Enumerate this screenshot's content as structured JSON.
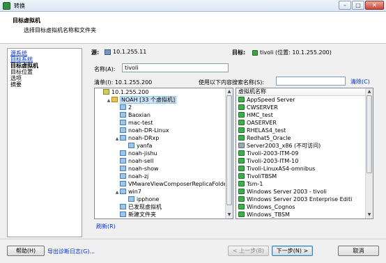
{
  "window": {
    "title": "转换",
    "controls": {
      "minimize": "–",
      "maximize": "□",
      "close": "✕"
    }
  },
  "header": {
    "title": "目标虚拟机",
    "subtitle": "选择目标虚拟机名称和文件夹"
  },
  "steps": [
    {
      "label": "源系统",
      "state": "link"
    },
    {
      "label": "目标系统",
      "state": "link"
    },
    {
      "label": "目标虚拟机",
      "state": "current"
    },
    {
      "label": "目标位置",
      "state": "pending"
    },
    {
      "label": "选项",
      "state": "pending"
    },
    {
      "label": "摘要",
      "state": "pending"
    }
  ],
  "source": {
    "label": "源:",
    "value": "10.1.255.11"
  },
  "target": {
    "label": "目标:",
    "value": "tivoli (位置: 10.1.255.200)"
  },
  "name_field": {
    "label": "名称(A):",
    "value": "tivoli"
  },
  "inventory": {
    "label": "清单(I): 10.1.255.200"
  },
  "search": {
    "label": "使用以下内容搜索名称(S):",
    "value": "",
    "clear_label": "清除(C)"
  },
  "tree": [
    {
      "label": "10.1.255.200",
      "indent": 0,
      "expander": "",
      "icon": "datacenter"
    },
    {
      "label": "NOAH [33 个虚拟机]",
      "indent": 1,
      "expander": "▲",
      "icon": "folder",
      "selected": true
    },
    {
      "label": "2",
      "indent": 2,
      "expander": "",
      "icon": "vmfolder"
    },
    {
      "label": "Baoxian",
      "indent": 2,
      "expander": "",
      "icon": "vmfolder"
    },
    {
      "label": "mac-test",
      "indent": 2,
      "expander": "",
      "icon": "vmfolder"
    },
    {
      "label": "noah-DR-Linux",
      "indent": 2,
      "expander": "",
      "icon": "vmfolder"
    },
    {
      "label": "noah-DRxp",
      "indent": 2,
      "expander": "▲",
      "icon": "vmfolder"
    },
    {
      "label": "yanfa",
      "indent": 3,
      "expander": "",
      "icon": "vmfolder"
    },
    {
      "label": "noah-jishu",
      "indent": 2,
      "expander": "",
      "icon": "vmfolder"
    },
    {
      "label": "noah-sell",
      "indent": 2,
      "expander": "",
      "icon": "vmfolder"
    },
    {
      "label": "noah-show",
      "indent": 2,
      "expander": "",
      "icon": "vmfolder"
    },
    {
      "label": "noah-zj",
      "indent": 2,
      "expander": "",
      "icon": "vmfolder"
    },
    {
      "label": "VMwareViewComposerReplicaFolde",
      "indent": 2,
      "expander": "",
      "icon": "vmfolder"
    },
    {
      "label": "win7",
      "indent": 2,
      "expander": "▲",
      "icon": "vmfolder"
    },
    {
      "label": "ipphone",
      "indent": 3,
      "expander": "",
      "icon": "vmfolder"
    },
    {
      "label": "已发现虚拟机",
      "indent": 2,
      "expander": "",
      "icon": "vmfolder"
    },
    {
      "label": "新建文件夹",
      "indent": 2,
      "expander": "",
      "icon": "vmfolder"
    }
  ],
  "vm_list": {
    "column_header": "虚拟机名称",
    "items": [
      {
        "name": "AppSpeed Server",
        "state": "on"
      },
      {
        "name": "CWSERVER",
        "state": "on"
      },
      {
        "name": "HMC_test",
        "state": "on"
      },
      {
        "name": "OASERVER",
        "state": "on"
      },
      {
        "name": "RHELAS4_test",
        "state": "on"
      },
      {
        "name": "Redhat5_Oracle",
        "state": "on"
      },
      {
        "name": "Server2003_x86 (不可访问)",
        "state": "off"
      },
      {
        "name": "Tivoli-2003-ITM-09",
        "state": "on"
      },
      {
        "name": "Tivoli-2003-ITM-10",
        "state": "on"
      },
      {
        "name": "Tivoli-LinuxAS4-omnibus",
        "state": "on"
      },
      {
        "name": "TivoliTBSM",
        "state": "on"
      },
      {
        "name": "Tsm-1",
        "state": "on"
      },
      {
        "name": "Windows Server 2003 - tivoli",
        "state": "on"
      },
      {
        "name": "Windows Server 2003 Enterprise Editi",
        "state": "on"
      },
      {
        "name": "Windows_Cognos",
        "state": "on"
      },
      {
        "name": "Windows_TBSM",
        "state": "on"
      }
    ]
  },
  "refresh_label": "刷新(R)",
  "footer": {
    "help_label": "帮助(H)",
    "export_label": "导出诊断日志(G)...",
    "back_label": "< 上一步(B)",
    "next_label": "下一步(N) >",
    "cancel_label": "取消"
  },
  "colors": {
    "link": "#0033cc",
    "selection": "#cde3f7",
    "vm_on": "#3fae4c"
  }
}
